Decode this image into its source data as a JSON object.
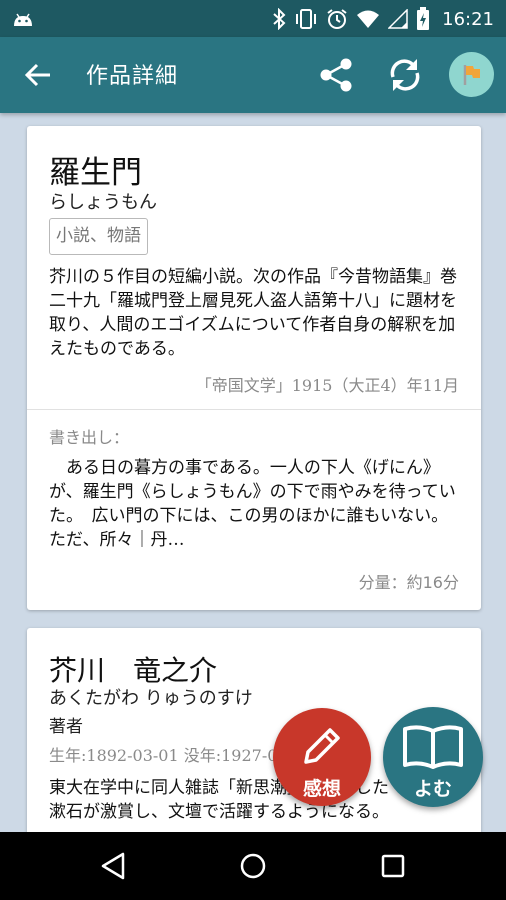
{
  "status_bar": {
    "time": "16:21",
    "icons": [
      "android-icon",
      "bluetooth-icon",
      "vibrate-icon",
      "alarm-icon",
      "wifi-icon",
      "no-signal-icon",
      "battery-charging-icon"
    ]
  },
  "app_bar": {
    "title": "作品詳細",
    "actions": [
      "back-icon",
      "share-icon",
      "refresh-icon",
      "flag-icon"
    ],
    "accent_color": "#2a7582",
    "flag_bg_color": "#8fd6cf"
  },
  "work": {
    "title": "羅生門",
    "reading": "らしょうもん",
    "genre": "小説、物語",
    "description": "芥川の５作目の短編小説。次の作品『今昔物語集』巻二十九「羅城門登上層見死人盗人語第十八」に題材を取り、人間のエゴイズムについて作者自身の解釈を加えたものである。",
    "publication": "「帝国文学」1915（大正4）年11月",
    "opening_label": "書き出し：",
    "opening": "ある日の暮方の事である。一人の下人《げにん》が、羅生門《らしょうもん》の下で雨やみを待っていた。　広い門の下には、この男のほかに誰もいない。ただ、所々｜丹…",
    "length": "分量：約16分"
  },
  "author": {
    "name": "芥川　竜之介",
    "reading": "あくたがわ りゅうのすけ",
    "role": "著者",
    "dates": "生年:1892-03-01 没年:1927-07-24",
    "description": "東大在学中に同人雑誌「新思潮」に発表した「鼻」を漱石が激賞し、文壇で活躍するようになる。"
  },
  "fabs": {
    "kanso_label": "感想",
    "kanso_color": "#c8372a",
    "yomu_label": "よむ",
    "yomu_color": "#2a7582"
  },
  "nav_bar": [
    "back-triangle-icon",
    "home-circle-icon",
    "recents-square-icon"
  ]
}
